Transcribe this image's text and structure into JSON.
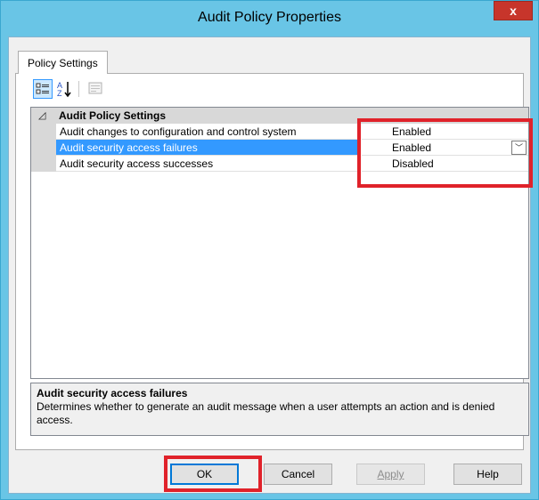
{
  "window": {
    "title": "Audit Policy Properties",
    "close_glyph": "x",
    "accent_color": "#69c5e6",
    "close_color": "#c7352b"
  },
  "tabs": [
    {
      "label": "Policy Settings",
      "selected": true
    }
  ],
  "toolbar": {
    "buttons": [
      {
        "icon": "categorized-view-icon",
        "pressed": true
      },
      {
        "icon": "alphabetical-sort-icon",
        "glyph": "A Z"
      },
      {
        "icon": "property-pages-icon",
        "disabled": true
      }
    ]
  },
  "grid": {
    "category": {
      "label": "Audit Policy Settings",
      "expand_glyph": "◿"
    },
    "rows": [
      {
        "name": "Audit changes to configuration and control system",
        "value": "Enabled"
      },
      {
        "name": "Audit security access failures",
        "value": "Enabled",
        "selected": true
      },
      {
        "name": "Audit security access successes",
        "value": "Disabled"
      }
    ],
    "dropdown_glyph": "﹀",
    "selection_color": "#3399ff"
  },
  "description": {
    "title": "Audit security access failures",
    "text": "Determines whether to generate an audit message when a user attempts an action and is denied access."
  },
  "buttons": {
    "ok": "OK",
    "cancel": "Cancel",
    "apply": "Apply",
    "help": "Help"
  },
  "annotation_color": "#e0222a"
}
